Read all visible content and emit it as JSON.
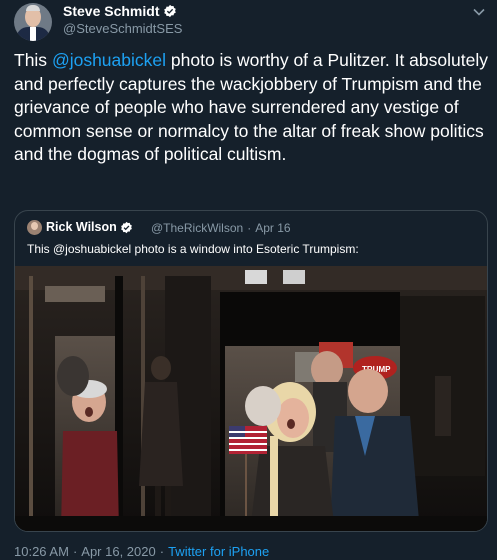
{
  "author": {
    "name": "Steve Schmidt",
    "handle": "@SteveSchmidtSES"
  },
  "tweet": {
    "text_before": "This ",
    "mention": "@joshuabickel",
    "text_after": " photo is worthy of a Pulitzer. It absolutely and perfectly captures the wackjobbery of Trumpism and the grievance of people who have surrendered any vestige of common sense or normalcy to the altar of freak show politics and the dogmas of political cultism."
  },
  "quoted_tweet": {
    "name": "Rick Wilson",
    "handle": "@TheRickWilson",
    "separator": "·",
    "date": "Apr 16",
    "text": "This @joshuabickel photo is a window into Esoteric Trumpism:",
    "photo_hat_text": "TRUMP"
  },
  "footer": {
    "time": "10:26 AM",
    "separator": "·",
    "date": "Apr 16, 2020",
    "separator2": "·",
    "source": "Twitter for iPhone"
  },
  "icons": [
    "verified-badge-icon",
    "chevron-down-icon"
  ],
  "colors": {
    "background": "#15202b",
    "accent": "#1da1f2",
    "secondary_text": "#8899a6",
    "border": "#38444d"
  }
}
